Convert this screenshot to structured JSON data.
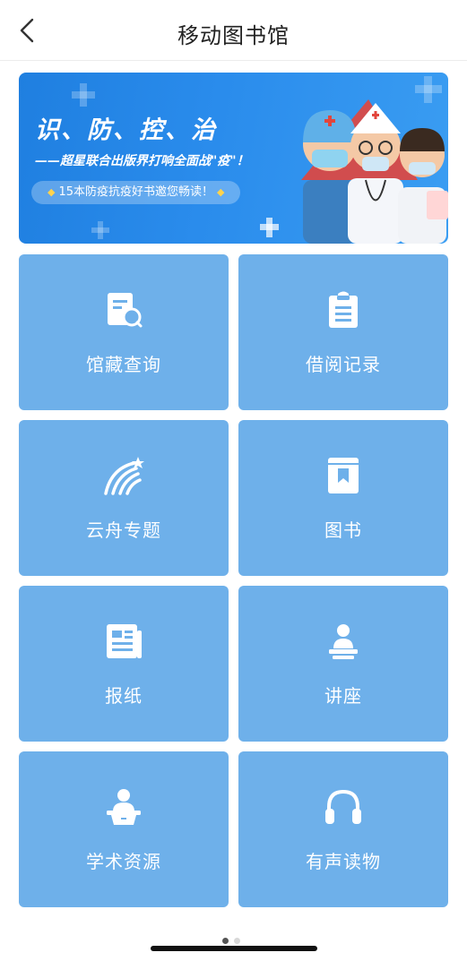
{
  "header": {
    "title": "移动图书馆",
    "back_icon": "chevron-left-icon"
  },
  "banner": {
    "title": "识、防、控、治",
    "subtitle": "——超星联合出版界打响全面战\"疫\"！",
    "pill_text": "15本防疫抗疫好书邀您畅读！"
  },
  "tiles": [
    {
      "label": "馆藏查询",
      "icon": "catalog-search-icon"
    },
    {
      "label": "借阅记录",
      "icon": "clipboard-icon"
    },
    {
      "label": "云舟专题",
      "icon": "cloud-boat-logo-icon"
    },
    {
      "label": "图书",
      "icon": "book-icon"
    },
    {
      "label": "报纸",
      "icon": "newspaper-icon"
    },
    {
      "label": "讲座",
      "icon": "lecture-icon"
    },
    {
      "label": "学术资源",
      "icon": "academic-resource-icon"
    },
    {
      "label": "有声读物",
      "icon": "headphones-icon"
    }
  ],
  "pager": {
    "current": 1,
    "total": 2
  },
  "colors": {
    "tile": "#6eb0ea",
    "banner": "#2a8cec"
  }
}
